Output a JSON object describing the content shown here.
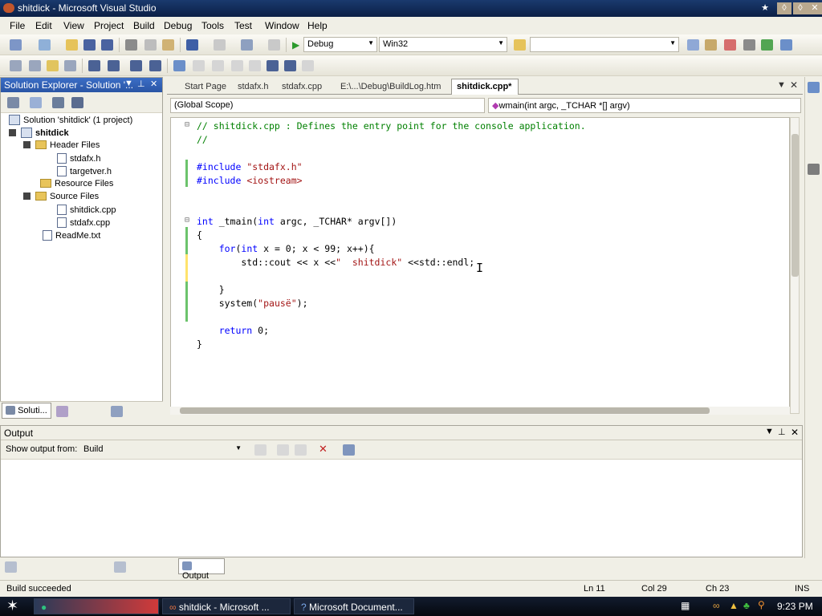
{
  "window": {
    "title": "shitdick - Microsoft Visual Studio"
  },
  "menu": [
    "File",
    "Edit",
    "View",
    "Project",
    "Build",
    "Debug",
    "Tools",
    "Test",
    "Window",
    "Help"
  ],
  "toolbar": {
    "config": "Debug",
    "platform": "Win32"
  },
  "solution_explorer": {
    "title": "Solution Explorer - Solution '...",
    "solution": "Solution 'shitdick' (1 project)",
    "project": "shitdick",
    "header_files": "Header Files",
    "h1": "stdafx.h",
    "h2": "targetver.h",
    "resource_files": "Resource Files",
    "source_files": "Source Files",
    "s1": "shitdick.cpp",
    "s2": "stdafx.cpp",
    "readme": "ReadMe.txt",
    "tab_label": "Soluti..."
  },
  "editor": {
    "tabs": [
      "Start Page",
      "stdafx.h",
      "stdafx.cpp",
      "E:\\...\\Debug\\BuildLog.htm"
    ],
    "active_tab": "shitdick.cpp*",
    "scope": "(Global Scope)",
    "function": "wmain(int argc, _TCHAR *[] argv)",
    "code": {
      "l1": "// shitdick.cpp : Defines the entry point for the console application.",
      "l2": "//",
      "l3a": "#include ",
      "l3b": "\"stdafx.h\"",
      "l4a": "#include ",
      "l4b": "<iostream>",
      "l5a": "int",
      " l5b": " _tmain(",
      "l5c": "int",
      " l5d": " argc, _TCHAR* argv[])",
      "l6": "{",
      "l7a": "    for",
      "l7b": "(",
      "l7c": "int",
      "l7d": " x = 0; x < 99; x++){",
      "l8a": "        std::cout << x <<",
      "l8b": "\"  shitdick\"",
      "l8c": " <<std::endl;",
      "l9": "    }",
      "l10a": "    system(",
      "l10b": "\"pausë\"",
      "l10c": ");",
      "l11a": "    return",
      " l11b": " 0;",
      "l12": "}"
    }
  },
  "output": {
    "title": "Output",
    "show_from_label": "Show output from:",
    "source": "Build",
    "tab": "Output"
  },
  "status": {
    "message": "Build succeeded",
    "ln": "Ln 11",
    "col": "Col 29",
    "ch": "Ch 23",
    "mode": "INS"
  },
  "taskbar": {
    "t1": "shitdick - Microsoft ...",
    "t2": "Microsoft Document...",
    "clock": "9:23 PM"
  }
}
